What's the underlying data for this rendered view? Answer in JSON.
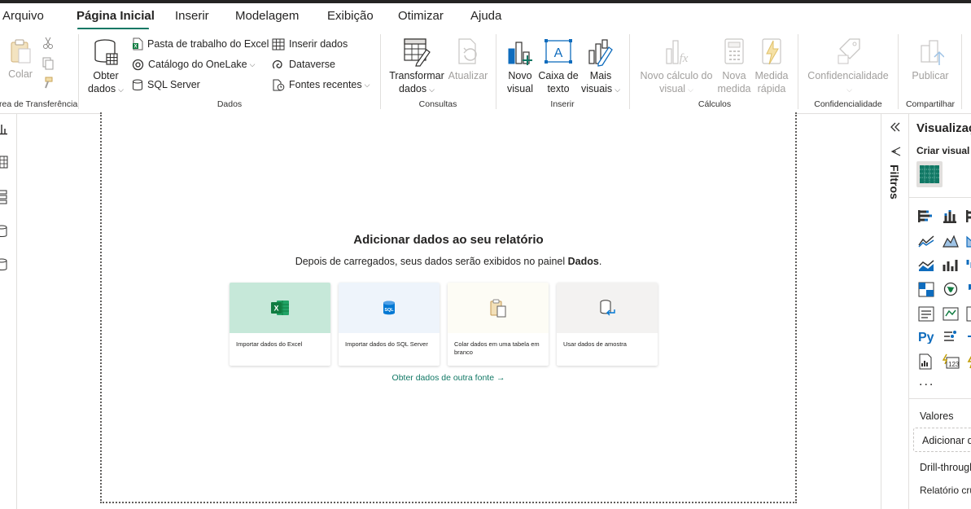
{
  "menu": {
    "tabs": [
      "Arquivo",
      "Página Inicial",
      "Inserir",
      "Modelagem",
      "Exibição",
      "Otimizar",
      "Ajuda"
    ],
    "active": "Página Inicial"
  },
  "ribbon": {
    "clipboard": {
      "paste": "Colar",
      "label": "Área de Transferência"
    },
    "data": {
      "get_data_l1": "Obter",
      "get_data_l2": "dados",
      "excel_workbook": "Pasta de trabalho do Excel",
      "onelake": "Catálogo do OneLake",
      "sql_server": "SQL Server",
      "enter_data": "Inserir dados",
      "dataverse": "Dataverse",
      "recent_sources": "Fontes recentes",
      "label": "Dados"
    },
    "queries": {
      "transform_l1": "Transformar",
      "transform_l2": "dados",
      "refresh": "Atualizar",
      "label": "Consultas"
    },
    "insert": {
      "new_visual_l1": "Novo",
      "new_visual_l2": "visual",
      "text_box_l1": "Caixa de",
      "text_box_l2": "texto",
      "more_visuals_l1": "Mais",
      "more_visuals_l2": "visuais",
      "label": "Inserir"
    },
    "calculations": {
      "new_visual_calc_l1": "Novo cálculo do",
      "new_visual_calc_l2": "visual",
      "new_measure_l1": "Nova",
      "new_measure_l2": "medida",
      "quick_measure_l1": "Medida",
      "quick_measure_l2": "rápida",
      "label": "Cálculos"
    },
    "sensitivity": {
      "btn": "Confidencialidade",
      "label": "Confidencialidade"
    },
    "share": {
      "publish": "Publicar",
      "label": "Compartilhar"
    }
  },
  "canvas": {
    "title": "Adicionar dados ao seu relatório",
    "subtitle_prefix": "Depois de carregados, seus dados serão exibidos no painel ",
    "subtitle_bold": "Dados",
    "subtitle_suffix": ".",
    "cards": [
      {
        "label": "Importar dados do Excel",
        "bg": "#c6e8d9"
      },
      {
        "label": "Importar dados do SQL Server",
        "bg": "#eef4fb"
      },
      {
        "label": "Colar dados em uma tabela em branco",
        "bg": "#fdfcf5"
      },
      {
        "label": "Usar dados de amostra",
        "bg": "#f3f2f1"
      }
    ],
    "other_source": "Obter dados de outra fonte →"
  },
  "filters": {
    "label": "Filtros"
  },
  "viz": {
    "title": "Visualizações",
    "build": "Criar visual",
    "more": "...",
    "values": "Valores",
    "add_data": "Adicionar dados",
    "drillthrough": "Drill-through",
    "cross_report": "Relatório cruzado"
  },
  "colors": {
    "accent": "#117865",
    "excel": "#107c41",
    "sql": "#0078d4"
  }
}
